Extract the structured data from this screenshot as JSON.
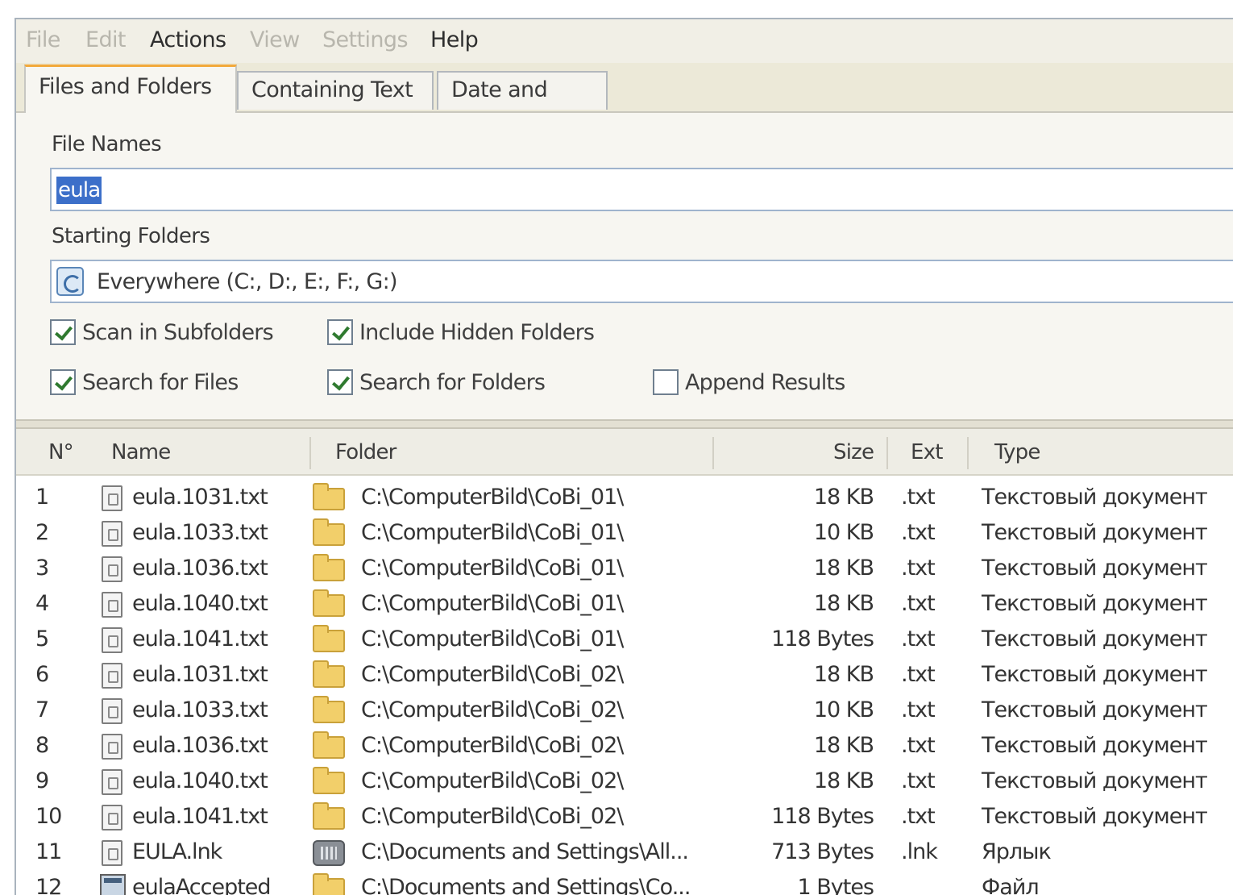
{
  "menu": [
    {
      "label": "File",
      "enabled": false
    },
    {
      "label": "Edit",
      "enabled": false
    },
    {
      "label": "Actions",
      "enabled": true
    },
    {
      "label": "View",
      "enabled": false
    },
    {
      "label": "Settings",
      "enabled": false
    },
    {
      "label": "Help",
      "enabled": true
    }
  ],
  "tabs": [
    {
      "label": "Files and Folders",
      "active": true
    },
    {
      "label": "Containing Text",
      "active": false
    },
    {
      "label": "Date and Size",
      "active": false
    }
  ],
  "file_names": {
    "label": "File Names",
    "value": "eula"
  },
  "starting_folders": {
    "label": "Starting Folders",
    "value": "Everywhere (C:, D:, E:, F:, G:)",
    "icon": "drive-search-icon"
  },
  "options": {
    "scan_subfolders": {
      "label": "Scan in Subfolders",
      "checked": true
    },
    "include_hidden": {
      "label": "Include Hidden Folders",
      "checked": true
    },
    "search_files": {
      "label": "Search for Files",
      "checked": true
    },
    "search_folders": {
      "label": "Search for Folders",
      "checked": true
    },
    "append_results": {
      "label": "Append Results",
      "checked": false
    }
  },
  "results": {
    "columns": {
      "num": "N°",
      "name": "Name",
      "folder": "Folder",
      "size": "Size",
      "ext": "Ext",
      "type": "Type"
    },
    "rows": [
      {
        "num": "1",
        "name": "eula.1031.txt",
        "folder": "C:\\ComputerBild\\CoBi_01\\",
        "size": "18 KB",
        "ext": ".txt",
        "type": "Текстовый документ",
        "icon": "text-file-icon",
        "folder_icon": "folder-icon"
      },
      {
        "num": "2",
        "name": "eula.1033.txt",
        "folder": "C:\\ComputerBild\\CoBi_01\\",
        "size": "10 KB",
        "ext": ".txt",
        "type": "Текстовый документ",
        "icon": "text-file-icon",
        "folder_icon": "folder-icon"
      },
      {
        "num": "3",
        "name": "eula.1036.txt",
        "folder": "C:\\ComputerBild\\CoBi_01\\",
        "size": "18 KB",
        "ext": ".txt",
        "type": "Текстовый документ",
        "icon": "text-file-icon",
        "folder_icon": "folder-icon"
      },
      {
        "num": "4",
        "name": "eula.1040.txt",
        "folder": "C:\\ComputerBild\\CoBi_01\\",
        "size": "18 KB",
        "ext": ".txt",
        "type": "Текстовый документ",
        "icon": "text-file-icon",
        "folder_icon": "folder-icon"
      },
      {
        "num": "5",
        "name": "eula.1041.txt",
        "folder": "C:\\ComputerBild\\CoBi_01\\",
        "size": "118 Bytes",
        "ext": ".txt",
        "type": "Текстовый документ",
        "icon": "text-file-icon",
        "folder_icon": "folder-icon"
      },
      {
        "num": "6",
        "name": "eula.1031.txt",
        "folder": "C:\\ComputerBild\\CoBi_02\\",
        "size": "18 KB",
        "ext": ".txt",
        "type": "Текстовый документ",
        "icon": "text-file-icon",
        "folder_icon": "folder-icon"
      },
      {
        "num": "7",
        "name": "eula.1033.txt",
        "folder": "C:\\ComputerBild\\CoBi_02\\",
        "size": "10 KB",
        "ext": ".txt",
        "type": "Текстовый документ",
        "icon": "text-file-icon",
        "folder_icon": "folder-icon"
      },
      {
        "num": "8",
        "name": "eula.1036.txt",
        "folder": "C:\\ComputerBild\\CoBi_02\\",
        "size": "18 KB",
        "ext": ".txt",
        "type": "Текстовый документ",
        "icon": "text-file-icon",
        "folder_icon": "folder-icon"
      },
      {
        "num": "9",
        "name": "eula.1040.txt",
        "folder": "C:\\ComputerBild\\CoBi_02\\",
        "size": "18 KB",
        "ext": ".txt",
        "type": "Текстовый документ",
        "icon": "text-file-icon",
        "folder_icon": "folder-icon"
      },
      {
        "num": "10",
        "name": "eula.1041.txt",
        "folder": "C:\\ComputerBild\\CoBi_02\\",
        "size": "118 Bytes",
        "ext": ".txt",
        "type": "Текстовый документ",
        "icon": "text-file-icon",
        "folder_icon": "folder-icon"
      },
      {
        "num": "11",
        "name": "EULA.lnk",
        "folder": "C:\\Documents and Settings\\All...",
        "size": "713 Bytes",
        "ext": ".lnk",
        "type": "Ярлык",
        "icon": "text-file-icon",
        "folder_icon": "shortcut-folder-icon"
      },
      {
        "num": "12",
        "name": "eulaAccepted",
        "folder": "C:\\Documents and Settings\\Co...",
        "size": "1 Bytes",
        "ext": "",
        "type": "Файл",
        "icon": "application-file-icon",
        "folder_icon": "folder-icon"
      }
    ]
  },
  "colors": {
    "accent_tab": "#f2a93b",
    "selection": "#3c6fc9",
    "window_bg": "#ece9d8",
    "folder": "#f2cf6a"
  }
}
